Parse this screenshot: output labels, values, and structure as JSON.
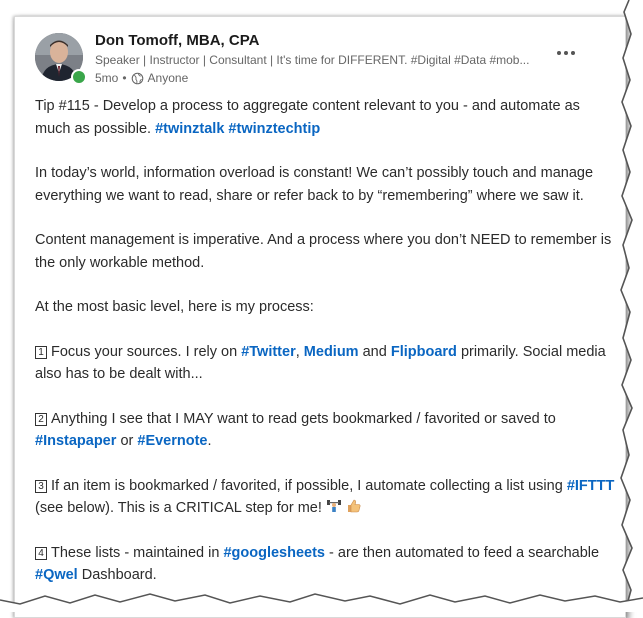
{
  "author": {
    "name": "Don Tomoff, MBA, CPA",
    "headline": "Speaker | Instructor | Consultant | It's time for DIFFERENT. #Digital #Data #mob...",
    "time": "5mo",
    "separator": "•",
    "visibility": "Anyone",
    "presence_color": "#3aa64a"
  },
  "post": {
    "p1_text": "Tip #115 - Develop a process to aggregate content relevant to you - and automate as much as possible.",
    "p1_tag1": "#twinztalk",
    "p1_tag2": "#twinztechtip",
    "p2": "In today’s world, information overload is constant! We can’t possibly touch and manage everything we want to read, share  or refer back to by “remembering” where we saw it.",
    "p3": "Content management is imperative. And a process where you don’t NEED to remember is the only workable method.",
    "p4": "At the most basic level, here is my process:",
    "item1": {
      "num": "1",
      "text_a": "Focus your sources. I rely on",
      "tag_a": "#Twitter",
      "comma": ",",
      "tag_b": "Medium",
      "and": "and",
      "tag_c": "Flipboard",
      "text_b": "primarily. Social media also has to be dealt with..."
    },
    "item2": {
      "num": "2",
      "text_a": "Anything I see that I MAY want to read gets bookmarked / favorited or saved to",
      "tag_a": "#Instapaper",
      "or": "or",
      "tag_b": "#Evernote",
      "dot": "."
    },
    "item3": {
      "num": "3",
      "text_a": "If an item is bookmarked / favorited, if possible, I automate collecting a list using",
      "tag_a": "#IFTTT",
      "text_b": "(see below). This is a CRITICAL step for me!"
    },
    "item4": {
      "num": "4",
      "text_a": "These lists - maintained in",
      "tag_a": "#googlesheets",
      "text_b": "- are then automated to feed a searchable",
      "tag_b": "#Qwel",
      "text_c": "Dashboard."
    }
  },
  "colors": {
    "link": "#0a66c2",
    "text": "#2b2b2b",
    "muted": "#666666"
  },
  "icons": [
    "globe-icon",
    "more-options-icon",
    "weightlifter-emoji",
    "thumbs-up-emoji"
  ]
}
